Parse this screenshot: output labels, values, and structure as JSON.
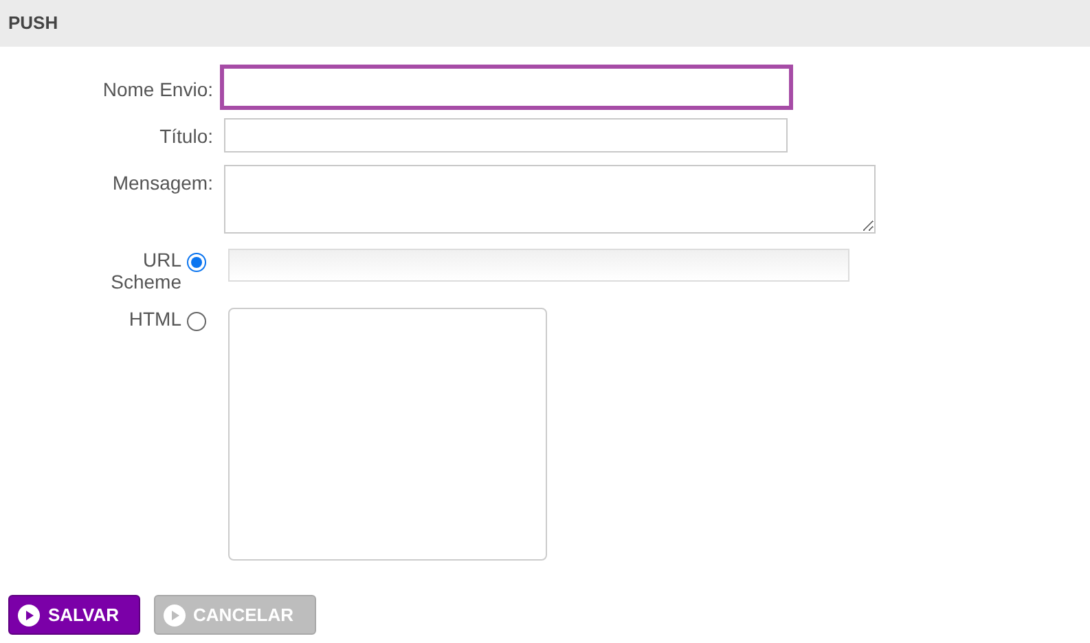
{
  "header": {
    "title": "PUSH"
  },
  "fields": [
    {
      "kind": "input",
      "label": "Nome Envio:",
      "focused": true
    },
    {
      "kind": "input",
      "label": "Título:",
      "focused": false
    },
    {
      "kind": "textarea",
      "label": "Mensagem:",
      "focused": false
    }
  ],
  "content_options": [
    {
      "kind": "input",
      "label": "URL Scheme",
      "selected": true
    },
    {
      "kind": "textarea",
      "label": "HTML",
      "selected": false
    }
  ],
  "buttons": [
    {
      "label": "SALVAR",
      "disabled": false
    },
    {
      "label": "CANCELAR",
      "disabled": true
    }
  ]
}
